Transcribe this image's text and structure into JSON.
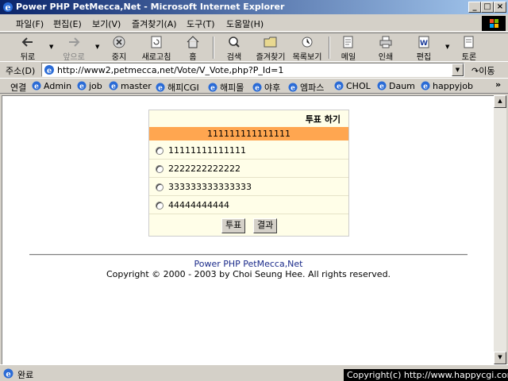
{
  "window": {
    "title": "Power PHP PetMecca,Net - Microsoft Internet Explorer",
    "min": "_",
    "max": "□",
    "close": "×"
  },
  "menu": [
    "파일(F)",
    "편집(E)",
    "보기(V)",
    "즐겨찾기(A)",
    "도구(T)",
    "도움말(H)"
  ],
  "toolbar": {
    "back": "뒤로",
    "forward": "앞으로",
    "stop": "중지",
    "refresh": "새로고침",
    "home": "홈",
    "search": "검색",
    "favorites": "즐겨찾기",
    "history": "목록보기",
    "mail": "메일",
    "print": "인쇄",
    "edit": "편집",
    "discuss": "토론"
  },
  "address": {
    "label": "주소(D)",
    "url": "http://www2,petmecca,net/Vote/V_Vote,php?P_Id=1",
    "go": "이동"
  },
  "links": {
    "label": "연결",
    "items": [
      "Admin",
      "job",
      "master",
      "해피CGI",
      "해피몰",
      "야후",
      "엠파스",
      "CHOL",
      "Daum",
      "happyjob"
    ],
    "more": "»"
  },
  "vote": {
    "title": "투표 하기",
    "question": "111111111111111",
    "options": [
      "11111111111111",
      "2222222222222",
      "333333333333333",
      "44444444444"
    ],
    "vote_button": "투표",
    "result_button": "결과"
  },
  "footer": {
    "link": "Power PHP PetMecca,Net",
    "copyright": "Copyright © 2000 - 2003 by Choi Seung Hee. All rights reserved."
  },
  "status": {
    "text": "완료"
  },
  "watermark": "Copyright(c) http://www.happycgi.com"
}
